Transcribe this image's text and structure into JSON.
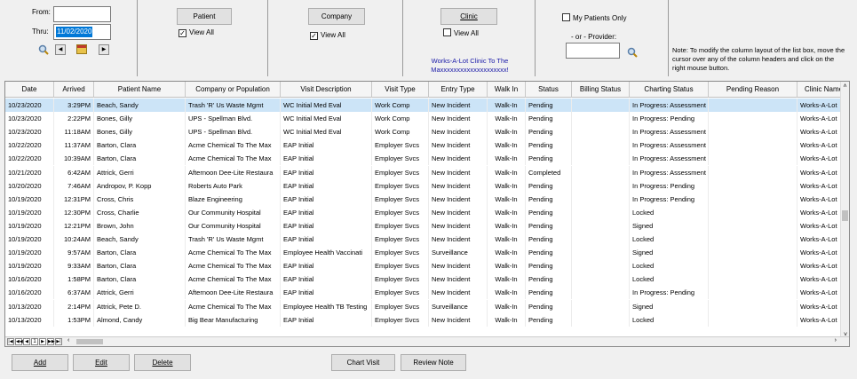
{
  "filters": {
    "from_label": "From:",
    "from_value": "",
    "thru_label": "Thru:",
    "thru_value": "11/02/2020"
  },
  "patient": {
    "button": "Patient",
    "view_all": "View All",
    "view_all_checked": true
  },
  "company": {
    "button": "Company",
    "view_all": "View All",
    "view_all_checked": true
  },
  "clinic": {
    "button": "Clinic",
    "view_all": "View All",
    "view_all_checked": false,
    "selected_line1": "Works-A-Lot Clinic To The",
    "selected_line2": "Maxxxxxxxxxxxxxxxxxxxx!"
  },
  "provider": {
    "my_patients_only": "My Patients Only",
    "or_provider": "- or - Provider:",
    "value": ""
  },
  "note": "Note: To modify the column layout of the list box, move the cursor over any of the column headers and click on the right mouse button.",
  "columns": [
    "Date",
    "Arrived",
    "Patient Name",
    "Company or Population",
    "Visit Description",
    "Visit Type",
    "Entry Type",
    "Walk In",
    "Status",
    "Billing Status",
    "Charting Status",
    "Pending Reason",
    "Clinic Name"
  ],
  "rows": [
    [
      "10/23/2020",
      "3:29PM",
      "Beach, Sandy",
      "Trash 'R' Us Waste Mgmt",
      "WC Initial Med Eval",
      "Work Comp",
      "New Incident",
      "Walk-In",
      "Pending",
      "",
      "In Progress: Assessment",
      "",
      "Works-A-Lot"
    ],
    [
      "10/23/2020",
      "2:22PM",
      "Bones, Gilly",
      "UPS - Spellman Blvd.",
      "WC Initial Med Eval",
      "Work Comp",
      "New Incident",
      "Walk-In",
      "Pending",
      "",
      "In Progress: Pending",
      "",
      "Works-A-Lot"
    ],
    [
      "10/23/2020",
      "11:18AM",
      "Bones, Gilly",
      "UPS - Spellman Blvd.",
      "WC Initial Med Eval",
      "Work Comp",
      "New Incident",
      "Walk-In",
      "Pending",
      "",
      "In Progress: Assessment",
      "",
      "Works-A-Lot"
    ],
    [
      "10/22/2020",
      "11:37AM",
      "Barton, Clara",
      "Acme Chemical To The Max",
      "EAP Initial",
      "Employer Svcs",
      "New Incident",
      "Walk-In",
      "Pending",
      "",
      "In Progress: Assessment",
      "",
      "Works-A-Lot"
    ],
    [
      "10/22/2020",
      "10:39AM",
      "Barton, Clara",
      "Acme Chemical To The Max",
      "EAP Initial",
      "Employer Svcs",
      "New Incident",
      "Walk-In",
      "Pending",
      "",
      "In Progress: Assessment",
      "",
      "Works-A-Lot"
    ],
    [
      "10/21/2020",
      "6:42AM",
      "Attrick, Gerri",
      "Afternoon Dee-Lite Restaura",
      "EAP Initial",
      "Employer Svcs",
      "New Incident",
      "Walk-In",
      "Completed",
      "",
      "In Progress: Assessment",
      "",
      "Works-A-Lot"
    ],
    [
      "10/20/2020",
      "7:46AM",
      "Andropov, P. Kopp",
      "Roberts Auto Park",
      "EAP Initial",
      "Employer Svcs",
      "New Incident",
      "Walk-In",
      "Pending",
      "",
      "In Progress: Pending",
      "",
      "Works-A-Lot"
    ],
    [
      "10/19/2020",
      "12:31PM",
      "Cross, Chris",
      "Blaze Engineering",
      "EAP Initial",
      "Employer Svcs",
      "New Incident",
      "Walk-In",
      "Pending",
      "",
      "In Progress: Pending",
      "",
      "Works-A-Lot"
    ],
    [
      "10/19/2020",
      "12:30PM",
      "Cross, Charlie",
      "Our Community Hospital",
      "EAP Initial",
      "Employer Svcs",
      "New Incident",
      "Walk-In",
      "Pending",
      "",
      "Locked",
      "",
      "Works-A-Lot"
    ],
    [
      "10/19/2020",
      "12:21PM",
      "Brown, John",
      "Our Community Hospital",
      "EAP Initial",
      "Employer Svcs",
      "New Incident",
      "Walk-In",
      "Pending",
      "",
      "Signed",
      "",
      "Works-A-Lot"
    ],
    [
      "10/19/2020",
      "10:24AM",
      "Beach, Sandy",
      "Trash 'R' Us Waste Mgmt",
      "EAP Initial",
      "Employer Svcs",
      "New Incident",
      "Walk-In",
      "Pending",
      "",
      "Locked",
      "",
      "Works-A-Lot"
    ],
    [
      "10/19/2020",
      "9:57AM",
      "Barton, Clara",
      "Acme Chemical To The Max",
      "Employee Health Vaccinati",
      "Employer Svcs",
      "Surveillance",
      "Walk-In",
      "Pending",
      "",
      "Signed",
      "",
      "Works-A-Lot"
    ],
    [
      "10/19/2020",
      "9:33AM",
      "Barton, Clara",
      "Acme Chemical To The Max",
      "EAP Initial",
      "Employer Svcs",
      "New Incident",
      "Walk-In",
      "Pending",
      "",
      "Locked",
      "",
      "Works-A-Lot"
    ],
    [
      "10/16/2020",
      "1:58PM",
      "Barton, Clara",
      "Acme Chemical To The Max",
      "EAP Initial",
      "Employer Svcs",
      "New Incident",
      "Walk-In",
      "Pending",
      "",
      "Locked",
      "",
      "Works-A-Lot"
    ],
    [
      "10/16/2020",
      "6:37AM",
      "Attrick, Gerri",
      "Afternoon Dee-Lite Restaura",
      "EAP Initial",
      "Employer Svcs",
      "New Incident",
      "Walk-In",
      "Pending",
      "",
      "In Progress: Pending",
      "",
      "Works-A-Lot"
    ],
    [
      "10/13/2020",
      "2:14PM",
      "Attrick, Pete D.",
      "Acme Chemical To The Max",
      "Employee Health TB Testing",
      "Employer Svcs",
      "Surveillance",
      "Walk-In",
      "Pending",
      "",
      "Signed",
      "",
      "Works-A-Lot"
    ],
    [
      "10/13/2020",
      "1:53PM",
      "Almond, Candy",
      "Big Bear Manufacturing",
      "EAP Initial",
      "Employer Svcs",
      "New Incident",
      "Walk-In",
      "Pending",
      "",
      "Locked",
      "",
      "Works-A-Lot"
    ]
  ],
  "pager": {
    "page": "1"
  },
  "buttons": {
    "add": "Add",
    "edit": "Edit",
    "delete": "Delete",
    "chart_visit": "Chart Visit",
    "review_note": "Review Note"
  },
  "colors": {
    "selected_row": "#cce4f7",
    "date_highlight": "#0078d7"
  }
}
